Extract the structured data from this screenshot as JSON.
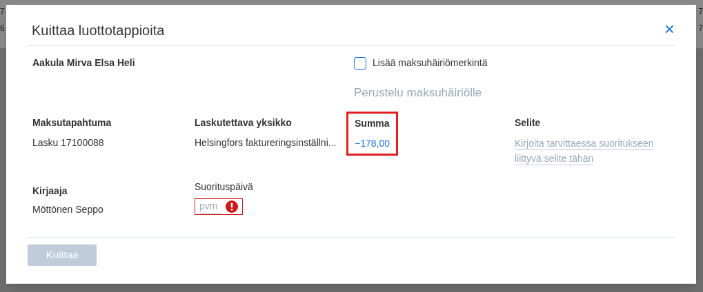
{
  "backdrop": {
    "left_fragments": [
      "7",
      "6"
    ],
    "right_fragments": [
      "7",
      "7"
    ]
  },
  "dialog": {
    "title": "Kuittaa luottotappioita",
    "close_icon": "×"
  },
  "customer": "Aakula Mirva Elsa Heli",
  "payment_disturbance": {
    "label": "Lisää maksuhäiriömerkintä",
    "checked": false,
    "reason_placeholder": "Perustelu maksuhäiriölle"
  },
  "fields": [
    {
      "kind": "text",
      "label": "Maksutapahtuma",
      "value": "Lasku 17100088",
      "highlighted": false
    },
    {
      "kind": "text",
      "label": "Laskutettava yksikko",
      "value": "Helsingfors faktureringsinställni...",
      "highlighted": false
    },
    {
      "kind": "amount",
      "label": "Summa",
      "value": "−178,00",
      "highlighted": true
    },
    {
      "kind": "note",
      "label": "Selite",
      "placeholder": "Kirjoita tarvittaessa suoritukseen liittyvä selite tähän",
      "highlighted": false
    }
  ],
  "booker": {
    "label": "Kirjaaja",
    "value": "Möttönen Seppo"
  },
  "payment_date": {
    "label": "Suorituspäivä",
    "placeholder": "pvm",
    "error": true
  },
  "submit": {
    "label": "Kuittaa",
    "disabled": true
  }
}
